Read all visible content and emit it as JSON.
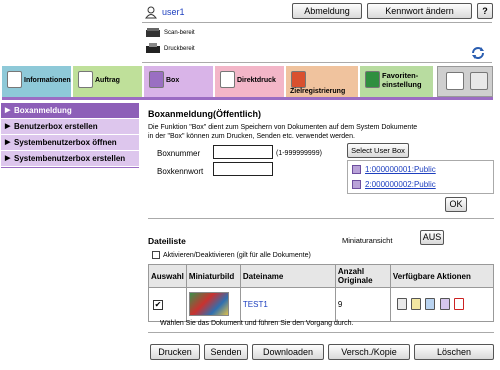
{
  "header": {
    "user_name": "user1",
    "logout_label": "Abmeldung",
    "change_password_label": "Kennwort ändern",
    "help_label": "?",
    "scan_status": "Scan-bereit",
    "print_status": "Druckbereit"
  },
  "tabs": [
    {
      "label": "Informationen"
    },
    {
      "label": "Auftrag"
    },
    {
      "label": "Box"
    },
    {
      "label": "Direktdruck"
    },
    {
      "label": "Zielregistrierung"
    },
    {
      "label": "Favoriten-\neinstellung"
    }
  ],
  "sidebar": {
    "items": [
      {
        "label": "Boxanmeldung"
      },
      {
        "label": "Benutzerbox erstellen"
      },
      {
        "label": "Systembenutzerbox öffnen"
      },
      {
        "label": "Systembenutzerbox erstellen"
      }
    ]
  },
  "login": {
    "title": "Boxanmeldung(Öffentlich)",
    "description": "Die Funktion \"Box\" dient zum Speichern von Dokumenten auf dem System Dokumente in der \"Box\" können zum Drucken, Senden etc. verwendet werden.",
    "box_number_label": "Boxnummer",
    "box_number_value": "",
    "box_number_hint": "(1-999999999)",
    "box_password_label": "Boxkennwort",
    "box_password_value": "",
    "select_user_box_label": "Select User Box",
    "user_boxes": [
      {
        "label": "1:000000001:Public"
      },
      {
        "label": "2:000000002:Public"
      }
    ],
    "ok_label": "OK"
  },
  "doc_list": {
    "title": "Dateiliste",
    "thumb_view_label": "Miniaturansicht",
    "thumb_view_value": "AUS",
    "toggle_all_label": "Aktivieren/Deaktivieren (gilt für alle Dokumente)",
    "columns": [
      "Auswahl",
      "Miniaturbild",
      "Dateiname",
      "Anzahl Originale",
      "Verfügbare Aktionen"
    ],
    "rows": [
      {
        "checked": true,
        "file_name": "TEST1",
        "originals": "9"
      }
    ],
    "hint": "Wählen Sie das Dokument und führen Sie den Vorgang durch."
  },
  "actions": {
    "print_label": "Drucken",
    "send_label": "Senden",
    "download_label": "Downloaden",
    "move_copy_label": "Versch./Kopie",
    "delete_label": "Löschen"
  },
  "colors": {
    "informationen_tab": "#8ec9d8",
    "auftrag_tab": "#bfe09a",
    "box_tab": "#d9b4e8",
    "direktdruck_tab": "#f3b6c8",
    "zielregistrierung_tab": "#f0c39e",
    "favoriten_tab": "#b8dca0",
    "sidebar_active": "#8d5fb8",
    "sidebar_inactive": "#ddc6ed"
  }
}
